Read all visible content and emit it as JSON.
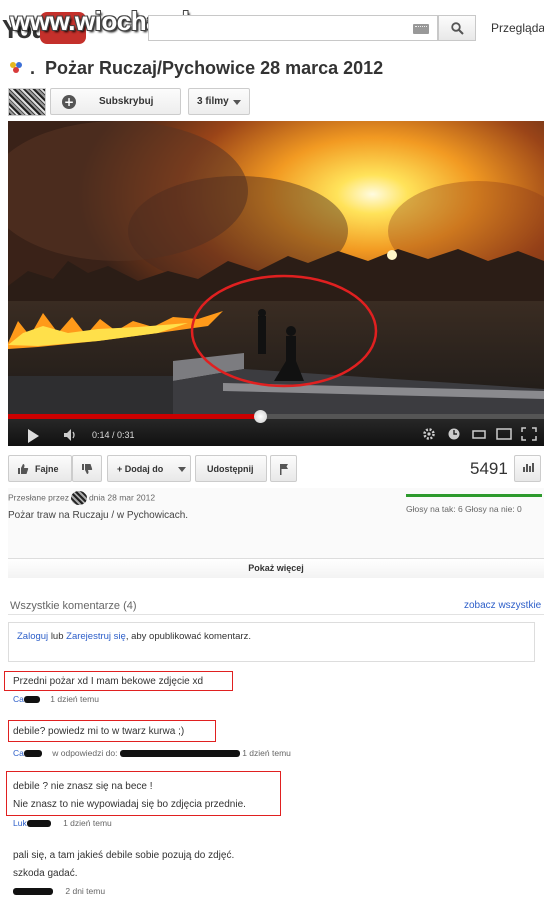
{
  "header": {
    "logo_text": "You",
    "watermark": "www.wiocha.pl",
    "browse_label": "Przeglądaj"
  },
  "video": {
    "title": "Pożar Ruczaj/Pychowice 28 marca 2012",
    "subscribe_label": "Subskrybuj",
    "films_label": "3 filmy",
    "time": "0:14 / 0:31",
    "progress": 0.47
  },
  "actions": {
    "like_label": "Fajne",
    "add_label": "+ Dodaj do",
    "share_label": "Udostępnij",
    "views": "5491"
  },
  "info": {
    "uploaded_prefix": "Przesłane przez",
    "uploaded_suffix": "dnia 28 mar 2012",
    "description": "Pożar traw na Ruczaju / w Pychowicach.",
    "votes": "Głosy na tak: 6 Głosy na nie: 0",
    "show_more": "Pokaż więcej"
  },
  "comments": {
    "header": "Wszystkie komentarze (4)",
    "see_all": "zobacz wszystkie",
    "login_link": "Zaloguj",
    "login_or": "lub",
    "register_link": "Zarejestruj się",
    "login_suffix": ", aby opublikować komentarz.",
    "items": [
      {
        "text": "Przedni pożar xd I mam bekowe zdjęcie xd",
        "user": "Ca",
        "time": "1 dzień temu"
      },
      {
        "text": "debile? powiedz mi to w twarz kurwa ;)",
        "user": "Ca",
        "reply_to": "w odpowiedzi do:",
        "time": "1 dzień temu"
      },
      {
        "text_line1": "debile ? nie znasz się na bece !",
        "text_line2": "Nie znasz to nie wypowiadaj się bo zdjęcia przednie.",
        "user": "Luk",
        "time": "1 dzień temu"
      },
      {
        "text_line1": "pali się, a tam jakieś debile sobie pozują do zdjęć.",
        "text_line2": "szkoda gadać.",
        "time": "2 dni temu"
      }
    ]
  },
  "colors": {
    "accent_red": "#e02020",
    "link_blue": "#2c5ec9",
    "like_green": "#2d9a2d",
    "progress_red": "#cc0000"
  }
}
